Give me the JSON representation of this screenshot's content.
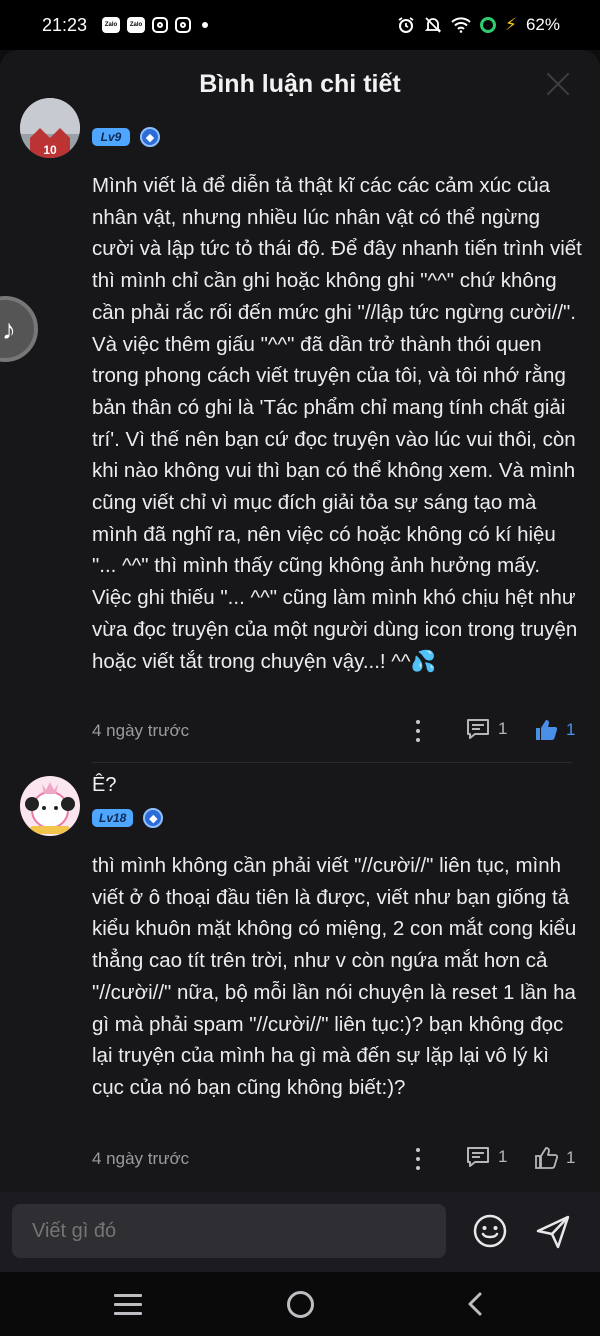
{
  "status_bar": {
    "time": "21:23",
    "notif_icons": [
      "zalo-icon",
      "zalo-icon",
      "instagram-icon",
      "instagram-icon"
    ],
    "battery": "62%"
  },
  "header": {
    "title": "Bình luận chi tiết"
  },
  "comments": [
    {
      "username": "",
      "level": "Lv9",
      "body": "Mình viết là để diễn tả thật kĩ các các cảm xúc của nhân vật, nhưng nhiều lúc nhân vật có thể ngừng cười và lập tức tỏ thái độ. Để đây nhanh tiến trình viết thì mình chỉ cần ghi hoặc không ghi \"^^\" chứ không cần phải rắc rối đến mức ghi \"//lập tức ngừng cười//\". Và việc thêm giấu \"^^\" đã dần trở thành thói quen trong phong cách viết truyện của tôi, và tôi nhớ rằng bản thân có ghi là 'Tác phẩm chỉ mang tính chất giải trí'. Vì thế nên bạn cứ đọc truyện vào lúc vui thôi, còn khi nào không vui thì bạn có thể không xem. Và mình cũng viết chỉ vì mục đích giải tỏa sự sáng tạo mà mình đã nghĩ ra, nên việc có hoặc không có kí hiệu \"... ^^\" thì mình thấy cũng không ảnh hưởng mấy. Việc ghi thiếu \"... ^^\" cũng làm mình khó chịu hệt như vừa đọc truyện của một người dùng icon trong truyện hoặc viết tắt trong chuyện vậy...! ^^💦",
      "time_ago": "4 ngày trước",
      "reply_count": "1",
      "like_count": "1"
    },
    {
      "username": "Ê?",
      "level": "Lv18",
      "body": "thì mình không cần phải viết \"//cười//\" liên tục, mình viết ở ô thoại đầu tiên là được, viết như bạn giống tả kiểu khuôn mặt không có miệng, 2 con mắt cong kiểu thẳng cao tít trên trời, như v còn ngứa mắt hơn cả \"//cười//\" nữa, bộ mỗi lần nói chuyện là reset 1 lần ha gì mà phải spam \"//cười//\" liên tục:)? bạn không đọc lại truyện của mình ha gì mà đến sự lặp lại vô lý kì cục của nó bạn cũng không biết:)?",
      "time_ago": "4 ngày trước",
      "reply_count": "1",
      "like_count": "1"
    }
  ],
  "input_bar": {
    "placeholder": "Viết gì đó"
  },
  "colors": {
    "accent": "#4a8fe7",
    "level_badge": "#4ea6ff",
    "sheet_bg": "#17171a"
  }
}
